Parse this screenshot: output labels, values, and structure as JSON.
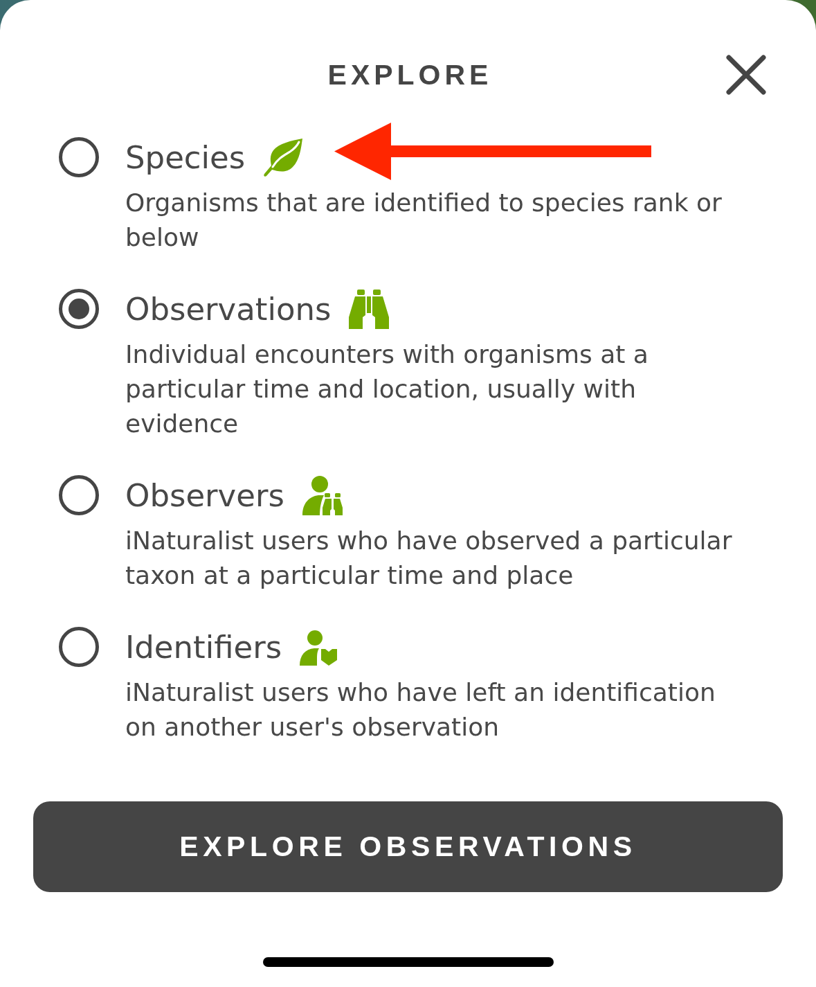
{
  "header": {
    "title": "EXPLORE"
  },
  "options": [
    {
      "kind": "species",
      "title": "Species",
      "description": "Organisms that are identified to species rank or below",
      "selected": false
    },
    {
      "kind": "observations",
      "title": "Observations",
      "description": "Individual encounters with organisms at a particular time and location, usually with evidence",
      "selected": true
    },
    {
      "kind": "observers",
      "title": "Observers",
      "description": "iNaturalist users who have observed a particular taxon at a particular time and place",
      "selected": false
    },
    {
      "kind": "identifiers",
      "title": "Identifiers",
      "description": "iNaturalist users who have left an identification on another user's observation",
      "selected": false
    }
  ],
  "annotation": {
    "kind": "arrow"
  },
  "button": {
    "label": "EXPLORE OBSERVATIONS"
  }
}
